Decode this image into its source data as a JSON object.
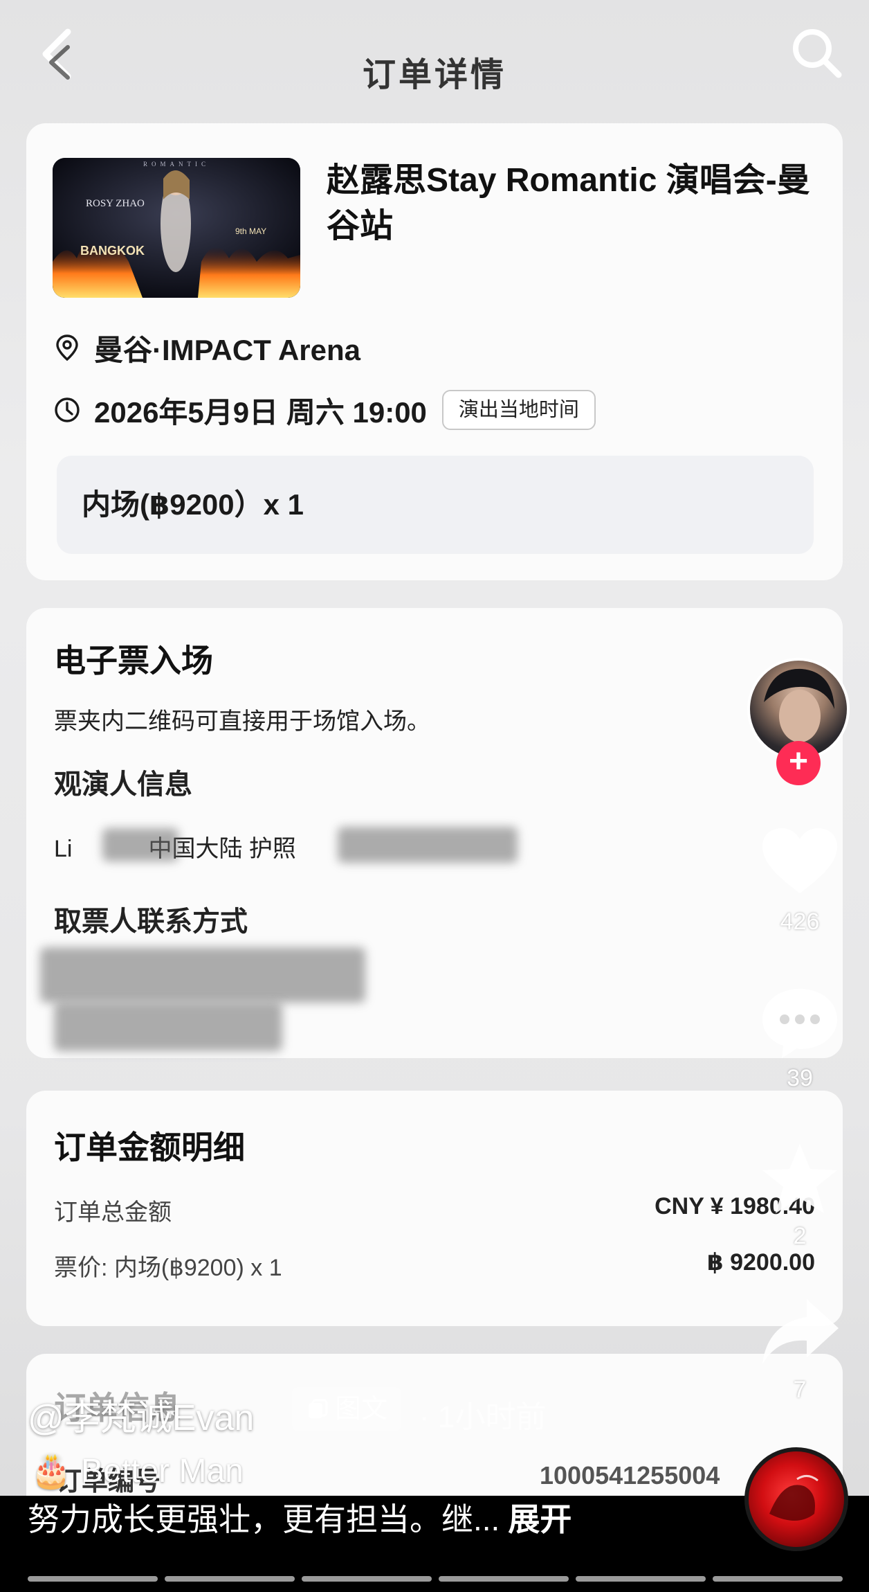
{
  "header": {
    "title": "订单详情"
  },
  "event": {
    "title": "赵露思Stay Romantic 演唱会-曼谷站",
    "poster": {
      "word_top": "ROMANTIC",
      "artist": "ROSY ZHAO",
      "city": "BANGKOK",
      "date": "9th MAY"
    },
    "venue": "曼谷·IMPACT Arena",
    "datetime": "2026年5月9日 周六 19:00",
    "local_time_label": "演出当地时间",
    "ticket": "内场(฿9200）x 1"
  },
  "eticket": {
    "title": "电子票入场",
    "desc": "票夹内二维码可直接用于场馆入场。",
    "attendee_title": "观演人信息",
    "attendee_prefix": "Li",
    "attendee_mid": "中国大陆 护照",
    "contact_title": "取票人联系方式"
  },
  "amount": {
    "title": "订单金额明细",
    "total_label": "订单总金额",
    "total_value": "CNY ¥ 1980.40",
    "price_label": "票价: 内场(฿9200) x 1",
    "price_value": "฿ 9200.00"
  },
  "order": {
    "title": "订单编号",
    "number": "1000541255004"
  },
  "social": {
    "likes": "426",
    "comments": "39",
    "favorites": "2",
    "shares": "7",
    "author": "@李梵诚Evan",
    "tag": "图文",
    "time_ago": "· 1小时前",
    "music": "🎂 Better Man",
    "caption": "努力成长更强壮，更有担当。继...",
    "expand": "展开",
    "follow_symbol": "+"
  },
  "colors": {
    "accent": "#fe2c55",
    "card": "#fbfbfb",
    "text": "#1a1a1a"
  }
}
